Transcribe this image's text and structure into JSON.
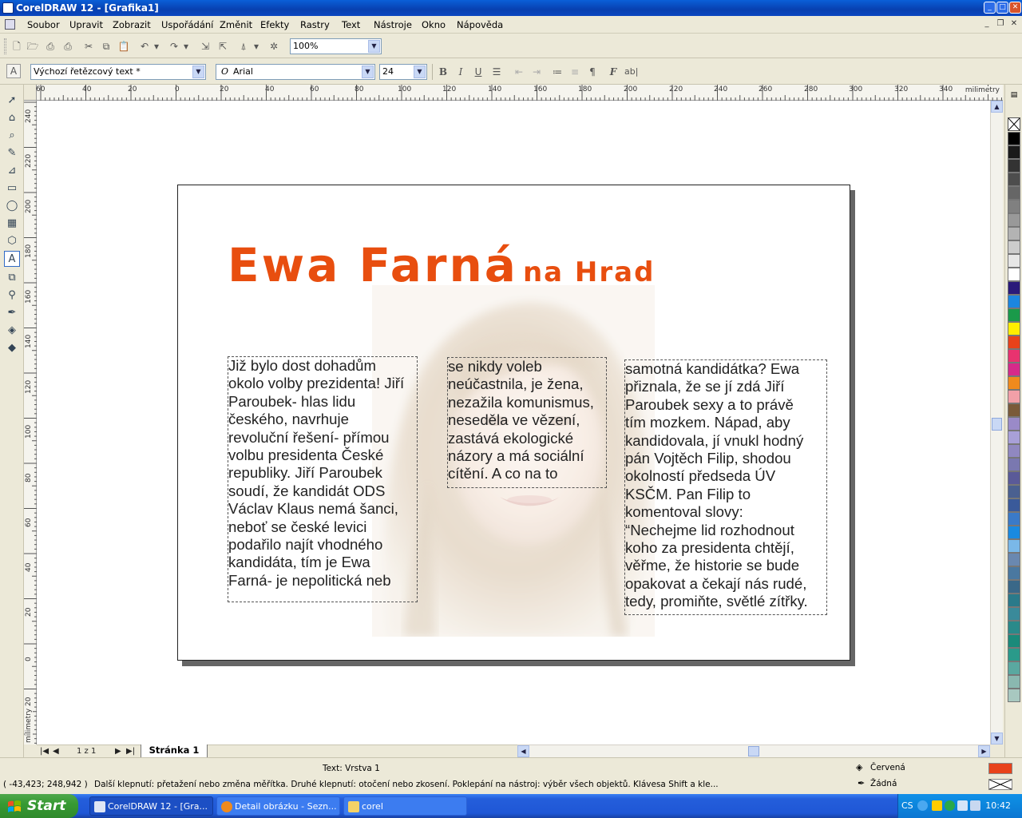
{
  "window": {
    "title": "CorelDRAW 12 - [Grafika1]",
    "min": "_",
    "max": "□",
    "close": "✕"
  },
  "menu": [
    "Soubor",
    "Upravit",
    "Zobrazit",
    "Uspořádání",
    "Změnit",
    "Efekty",
    "Rastry",
    "Text",
    "Nástroje",
    "Okno",
    "Nápověda"
  ],
  "standard_toolbar": {
    "zoom_value": "100%"
  },
  "text_toolbar": {
    "style_value": "Výchozí řetězcový text *",
    "font_value": "Arial",
    "size_value": "24",
    "bold": "B",
    "italic": "I",
    "underline": "U"
  },
  "ruler": {
    "unit": "milimetry",
    "h_labels": [
      "60",
      "40",
      "20",
      "0",
      "20",
      "40",
      "60",
      "80",
      "100",
      "120",
      "140",
      "160",
      "180",
      "200",
      "220",
      "240",
      "260",
      "280",
      "300",
      "320",
      "340"
    ],
    "v_labels": [
      "240",
      "220",
      "200",
      "180",
      "160",
      "140",
      "120",
      "100",
      "80",
      "60",
      "40",
      "20",
      "0",
      "20"
    ],
    "v_unit": "milimetry"
  },
  "document": {
    "heading_big": "Ewa Farná",
    "heading_small": "na Hrad",
    "column1": "Již bylo dost dohadům\nokolo volby prezidenta! Jiří\nParoubek- hlas lidu\nčeského, navrhuje\nrevoluční řešení- přímou\nvolbu presidenta České\nrepubliky. Jiří Paroubek\nsoudí, že kandidát ODS\nVáclav Klaus nemá šanci,\nneboť se české levici\npodařilo najít vhodného\nkandidáta, tím je Ewa\nFarná- je nepolitická neb",
    "column2": "se nikdy voleb\nneúčastnila, je žena,\nnezažila komunismus,\nneseděla ve vězení,\nzastává ekologické\nnázory a má sociální\ncítění. A co na to",
    "column3": "samotná kandidátka? Ewa\npřiznala, že se jí zdá Jiří\nParoubek sexy a to právě\ntím mozkem. Nápad, aby\nkandidovala, jí vnukl hodný\npán Vojtěch Filip, shodou\nokolností předseda ÚV\nKSČM. Pan Filip to\nkomentoval slovy:\n“Nechejme lid rozhodnout\nkoho za presidenta chtějí,\nvěřme, že historie se bude\nopakovat a čekají nás rudé,\ntedy, promiňte, světlé zítřky."
  },
  "page_nav": {
    "counter": "1 z 1",
    "tab_label": "Stránka 1"
  },
  "status": {
    "info": "Text: Vrstva 1",
    "coords": "( -43,423; 248,942 )",
    "hint": "Další klepnutí: přetažení nebo změna měřítka. Druhé klepnutí: otočení  nebo zkosení. Poklepání na nástroj: výběr všech objektů. Klávesa Shift a kle...",
    "fill_label": "Červená",
    "outline_label": "Žádná"
  },
  "colors": {
    "heading": "#e84e0f",
    "fill": "#e8421b",
    "palette": [
      "#000000",
      "#1a1a1a",
      "#333333",
      "#4d4d4d",
      "#666666",
      "#808080",
      "#999999",
      "#b3b3b3",
      "#cccccc",
      "#e6e6e6",
      "#ffffff",
      "#2a1a7a",
      "#1c86e0",
      "#1a9a4a",
      "#ffee00",
      "#e8421b",
      "#e8336f",
      "#d62a8a",
      "#f08a1c",
      "#f2a0a8",
      "#7a5a3a",
      "#9a8ac8",
      "#a8a0d8",
      "#9088c0",
      "#7a78b0",
      "#5a5a98",
      "#4a6090",
      "#3a5a9a",
      "#3a7ac8",
      "#1a8ae0",
      "#7ab8e8",
      "#6a88b0",
      "#4a78a0",
      "#3a6888",
      "#2a7a8a",
      "#3a8a9a",
      "#2a8a8a",
      "#1a8a7a",
      "#2a9a8a",
      "#5aa8a0",
      "#8ab8b0",
      "#a8c8c0"
    ]
  },
  "taskbar": {
    "start": "Start",
    "tasks": [
      "CorelDRAW 12 - [Gra...",
      "Detail obrázku - Sezn...",
      "corel"
    ],
    "lang": "CS",
    "clock": "10:42"
  }
}
